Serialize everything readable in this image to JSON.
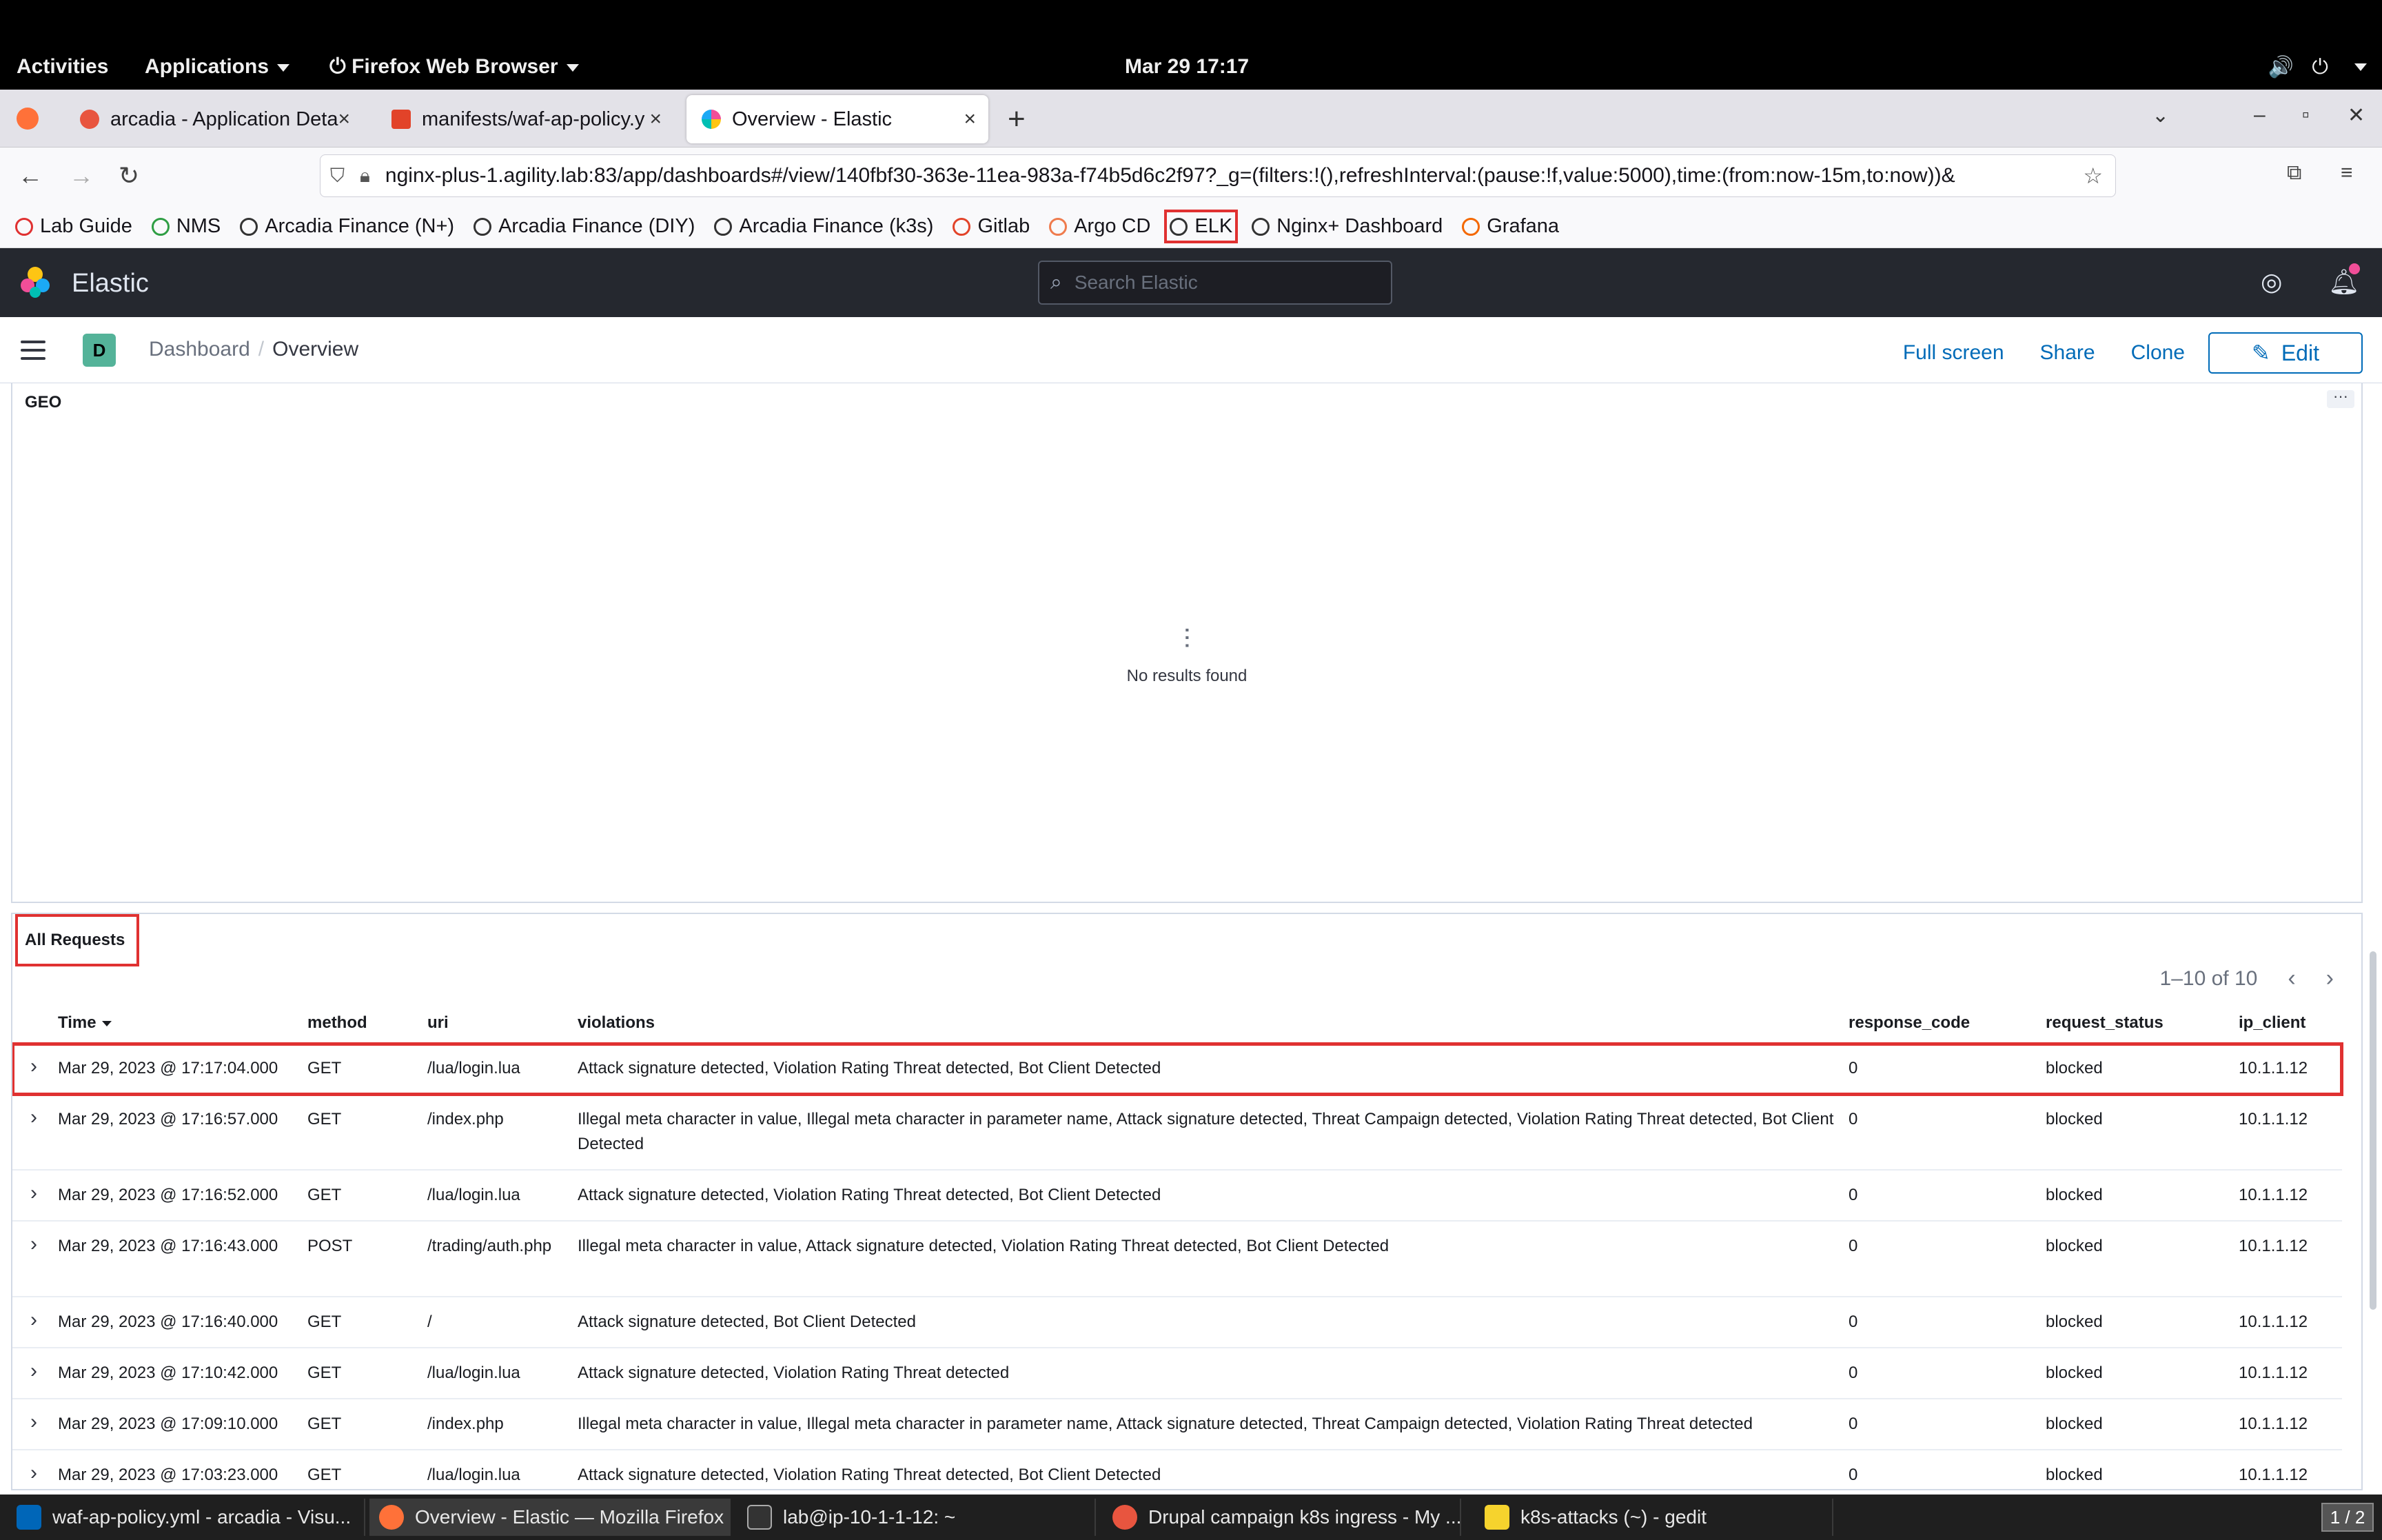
{
  "system": {
    "activities": "Activities",
    "applications": "Applications",
    "app_menu": "Firefox Web Browser",
    "clock": "Mar 29  17:17"
  },
  "browser": {
    "tabs": [
      {
        "label": "arcadia - Application Deta"
      },
      {
        "label": "manifests/waf-ap-policy.y"
      },
      {
        "label": "Overview - Elastic"
      }
    ],
    "url": "nginx-plus-1.agility.lab:83/app/dashboards#/view/140fbf30-363e-11ea-983a-f74b5d6c2f97?_g=(filters:!(),refreshInterval:(pause:!f,value:5000),time:(from:now-15m,to:now))&",
    "bookmarks": [
      "Lab Guide",
      "NMS",
      "Arcadia Finance (N+)",
      "Arcadia Finance (DIY)",
      "Arcadia Finance (k3s)",
      "Gitlab",
      "Argo CD",
      "ELK",
      "Nginx+ Dashboard",
      "Grafana"
    ]
  },
  "kibana": {
    "brand": "Elastic",
    "search_placeholder": "Search Elastic",
    "space_initial": "D",
    "breadcrumbs": [
      "Dashboard",
      "Overview"
    ],
    "actions": {
      "fullscreen": "Full screen",
      "share": "Share",
      "clone": "Clone",
      "edit": "Edit"
    }
  },
  "geo_panel": {
    "title": "GEO",
    "empty_message": "No results found"
  },
  "requests_panel": {
    "title": "All Requests",
    "pagination": "1–10 of 10",
    "columns": [
      "Time",
      "method",
      "uri",
      "violations",
      "response_code",
      "request_status",
      "ip_client"
    ],
    "rows": [
      {
        "time": "Mar 29, 2023 @ 17:17:04.000",
        "method": "GET",
        "uri": "/lua/login.lua",
        "violations": "Attack signature detected, Violation Rating Threat detected, Bot Client Detected",
        "response_code": "0",
        "request_status": "blocked",
        "ip_client": "10.1.1.12"
      },
      {
        "time": "Mar 29, 2023 @ 17:16:57.000",
        "method": "GET",
        "uri": "/index.php",
        "violations": "Illegal meta character in value, Illegal meta character in parameter name, Attack signature detected, Threat Campaign detected, Violation Rating Threat detected, Bot Client Detected",
        "response_code": "0",
        "request_status": "blocked",
        "ip_client": "10.1.1.12"
      },
      {
        "time": "Mar 29, 2023 @ 17:16:52.000",
        "method": "GET",
        "uri": "/lua/login.lua",
        "violations": "Attack signature detected, Violation Rating Threat detected, Bot Client Detected",
        "response_code": "0",
        "request_status": "blocked",
        "ip_client": "10.1.1.12"
      },
      {
        "time": "Mar 29, 2023 @ 17:16:43.000",
        "method": "POST",
        "uri": "/trading/auth.php",
        "violations": "Illegal meta character in value, Attack signature detected, Violation Rating Threat detected, Bot Client Detected",
        "response_code": "0",
        "request_status": "blocked",
        "ip_client": "10.1.1.12"
      },
      {
        "time": "Mar 29, 2023 @ 17:16:40.000",
        "method": "GET",
        "uri": "/",
        "violations": "Attack signature detected, Bot Client Detected",
        "response_code": "0",
        "request_status": "blocked",
        "ip_client": "10.1.1.12"
      },
      {
        "time": "Mar 29, 2023 @ 17:10:42.000",
        "method": "GET",
        "uri": "/lua/login.lua",
        "violations": "Attack signature detected, Violation Rating Threat detected",
        "response_code": "0",
        "request_status": "blocked",
        "ip_client": "10.1.1.12"
      },
      {
        "time": "Mar 29, 2023 @ 17:09:10.000",
        "method": "GET",
        "uri": "/index.php",
        "violations": "Illegal meta character in value, Illegal meta character in parameter name, Attack signature detected, Threat Campaign detected, Violation Rating Threat detected",
        "response_code": "0",
        "request_status": "blocked",
        "ip_client": "10.1.1.12"
      },
      {
        "time": "Mar 29, 2023 @ 17:03:23.000",
        "method": "GET",
        "uri": "/lua/login.lua",
        "violations": "Attack signature detected, Violation Rating Threat detected, Bot Client Detected",
        "response_code": "0",
        "request_status": "blocked",
        "ip_client": "10.1.1.12"
      }
    ]
  },
  "taskbar": {
    "items": [
      "waf-ap-policy.yml - arcadia - Visu...",
      "Overview - Elastic — Mozilla Firefox",
      "lab@ip-10-1-1-12: ~",
      "Drupal campaign k8s ingress - My ...",
      "k8s-attacks (~) - gedit"
    ],
    "workspace": "1 / 2"
  }
}
